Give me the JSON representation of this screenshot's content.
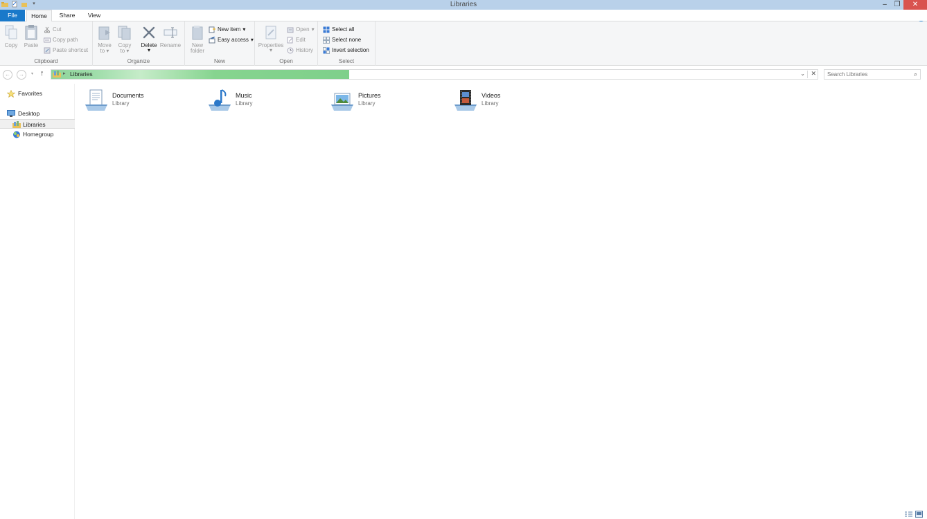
{
  "window": {
    "title": "Libraries"
  },
  "tabs": {
    "file": "File",
    "home": "Home",
    "share": "Share",
    "view": "View"
  },
  "ribbon": {
    "clipboard": {
      "title": "Clipboard",
      "copy": "Copy",
      "paste": "Paste",
      "cut": "Cut",
      "copy_path": "Copy path",
      "paste_shortcut": "Paste shortcut"
    },
    "organize": {
      "title": "Organize",
      "move_to": "Move",
      "move_to2": "to",
      "copy_to": "Copy",
      "copy_to2": "to",
      "delete": "Delete",
      "rename": "Rename"
    },
    "new": {
      "title": "New",
      "new_folder": "New",
      "new_folder2": "folder",
      "new_item": "New item",
      "easy_access": "Easy access"
    },
    "open": {
      "title": "Open",
      "properties": "Properties",
      "open": "Open",
      "edit": "Edit",
      "history": "History"
    },
    "select": {
      "title": "Select",
      "select_all": "Select all",
      "select_none": "Select none",
      "invert_selection": "Invert selection"
    }
  },
  "address": {
    "path": "Libraries",
    "search_placeholder": "Search Libraries"
  },
  "navpane": {
    "favorites": "Favorites",
    "desktop": "Desktop",
    "libraries": "Libraries",
    "homegroup": "Homegroup"
  },
  "libraries": [
    {
      "name": "Documents",
      "type": "Library",
      "icon": "documents-library-icon"
    },
    {
      "name": "Music",
      "type": "Library",
      "icon": "music-library-icon"
    },
    {
      "name": "Pictures",
      "type": "Library",
      "icon": "pictures-library-icon"
    },
    {
      "name": "Videos",
      "type": "Library",
      "icon": "videos-library-icon"
    }
  ],
  "colors": {
    "file_tab": "#1979ca",
    "titlebar": "#b9d1ea",
    "close": "#d9534f",
    "address_progress": "#86d48f"
  }
}
